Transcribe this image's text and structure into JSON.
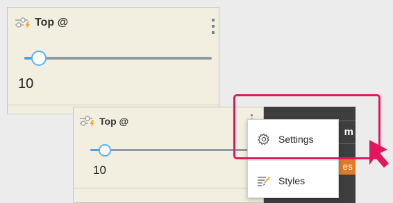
{
  "widget_main": {
    "title": "Top @",
    "value": "10",
    "slider_fraction": 0.08
  },
  "widget_popup": {
    "title": "Top @",
    "value": "10",
    "slider_fraction": 0.08
  },
  "background_panel": {
    "partial_text_1": "m",
    "partial_text_2": "es"
  },
  "context_menu": {
    "items": [
      {
        "label": "Settings",
        "icon": "gear-icon"
      },
      {
        "label": "Styles",
        "icon": "styles-icon"
      }
    ]
  },
  "colors": {
    "highlight": "#e2165c",
    "cursor": "#e2165c",
    "accent": "#58b2f0",
    "panel_bg": "#f2efe1",
    "dark_panel": "#3e3e3e",
    "orange_tab": "#e07a2a"
  }
}
